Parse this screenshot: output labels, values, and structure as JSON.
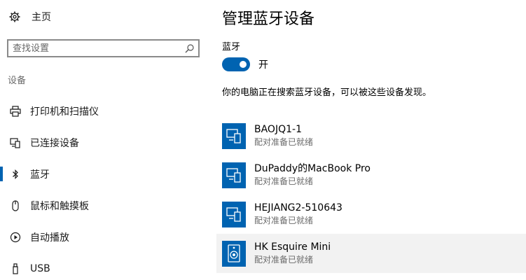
{
  "sidebar": {
    "home_label": "主页",
    "search_placeholder": "查找设置",
    "section_title": "设备",
    "items": [
      {
        "label": "打印机和扫描仪",
        "icon": "printer-icon"
      },
      {
        "label": "已连接设备",
        "icon": "connected-devices-icon"
      },
      {
        "label": "蓝牙",
        "icon": "bluetooth-icon",
        "active": true
      },
      {
        "label": "鼠标和触摸板",
        "icon": "mouse-icon"
      },
      {
        "label": "自动播放",
        "icon": "autoplay-icon"
      },
      {
        "label": "USB",
        "icon": "usb-icon"
      }
    ]
  },
  "main": {
    "title": "管理蓝牙设备",
    "bluetooth_label": "蓝牙",
    "toggle_state": "开",
    "status_text": "你的电脑正在搜索蓝牙设备，可以被这些设备发现。",
    "devices": [
      {
        "name": "BAOJQ1-1",
        "status": "配对准备已就绪",
        "icon": "computer-icon"
      },
      {
        "name": "DuPaddy的MacBook Pro",
        "status": "配对准备已就绪",
        "icon": "computer-icon"
      },
      {
        "name": "HEJIANG2-510643",
        "status": "配对准备已就绪",
        "icon": "computer-icon"
      },
      {
        "name": "HK Esquire Mini",
        "status": "配对准备已就绪",
        "icon": "speaker-icon"
      }
    ]
  },
  "colors": {
    "accent": "#0063b1",
    "selected_row": "#f2f2f2",
    "secondary_text": "#6b6b6b"
  }
}
